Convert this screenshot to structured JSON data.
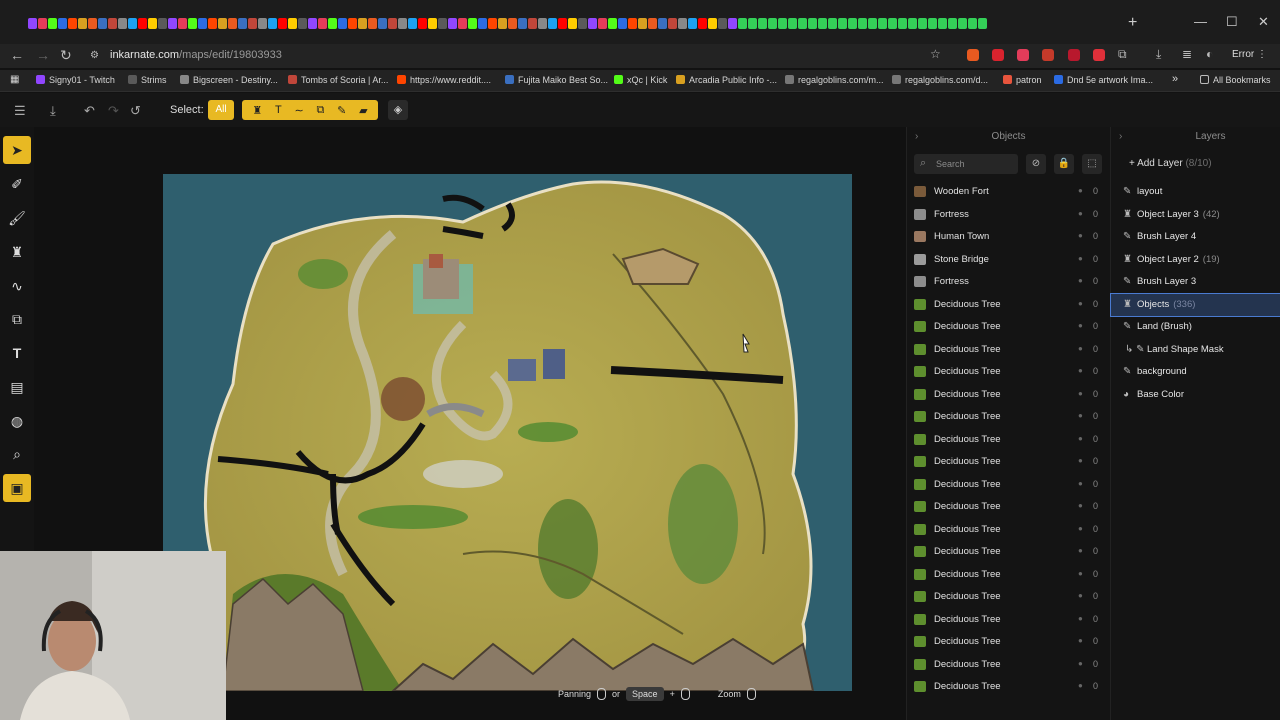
{
  "browser": {
    "url_host": "inkarnate.com",
    "url_path": "/maps/edit/19803933",
    "error_label": "Error",
    "bookmarks": [
      {
        "label": "Signy01 - Twitch",
        "color": "#9146ff"
      },
      {
        "label": "Strims",
        "color": "#5a5a5a"
      },
      {
        "label": "Bigscreen - Destiny...",
        "color": "#888888"
      },
      {
        "label": "Tombs of Scoria | Ar...",
        "color": "#c0463a"
      },
      {
        "label": "https://www.reddit....",
        "color": "#ff4500"
      },
      {
        "label": "Fujita Maiko Best So...",
        "color": "#3a6fc0"
      },
      {
        "label": "xQc | Kick",
        "color": "#53fc18"
      },
      {
        "label": "Arcadia Public Info -...",
        "color": "#d9a020"
      },
      {
        "label": "regalgoblins.com/m...",
        "color": "#777777"
      },
      {
        "label": "regalgoblins.com/d...",
        "color": "#777777"
      },
      {
        "label": "patron",
        "color": "#e8553d"
      },
      {
        "label": "Dnd 5e artwork Ima...",
        "color": "#2b6be3"
      }
    ],
    "all_bookmarks_label": "All Bookmarks"
  },
  "toolbar": {
    "select_label": "Select:",
    "all_label": "All",
    "accent_color": "#e8b923"
  },
  "canvas_hint": {
    "panning_label": "Panning",
    "or_label": "or",
    "space_label": "Space",
    "zoom_label": "Zoom"
  },
  "objects_panel": {
    "title": "Objects",
    "search_placeholder": "Search",
    "items": [
      {
        "name": "Wooden Fort",
        "count": "0",
        "thumb": "#7a5a3a"
      },
      {
        "name": "Fortress",
        "count": "0",
        "thumb": "#8d8d8d"
      },
      {
        "name": "Human Town",
        "count": "0",
        "thumb": "#9a7860"
      },
      {
        "name": "Stone Bridge",
        "count": "0",
        "thumb": "#9b9b9b"
      },
      {
        "name": "Fortress",
        "count": "0",
        "thumb": "#8d8d8d"
      },
      {
        "name": "Deciduous Tree",
        "count": "0",
        "thumb": "#5e8f2e"
      },
      {
        "name": "Deciduous Tree",
        "count": "0",
        "thumb": "#5e8f2e"
      },
      {
        "name": "Deciduous Tree",
        "count": "0",
        "thumb": "#5e8f2e"
      },
      {
        "name": "Deciduous Tree",
        "count": "0",
        "thumb": "#5e8f2e"
      },
      {
        "name": "Deciduous Tree",
        "count": "0",
        "thumb": "#5e8f2e"
      },
      {
        "name": "Deciduous Tree",
        "count": "0",
        "thumb": "#5e8f2e"
      },
      {
        "name": "Deciduous Tree",
        "count": "0",
        "thumb": "#5e8f2e"
      },
      {
        "name": "Deciduous Tree",
        "count": "0",
        "thumb": "#5e8f2e"
      },
      {
        "name": "Deciduous Tree",
        "count": "0",
        "thumb": "#5e8f2e"
      },
      {
        "name": "Deciduous Tree",
        "count": "0",
        "thumb": "#5e8f2e"
      },
      {
        "name": "Deciduous Tree",
        "count": "0",
        "thumb": "#5e8f2e"
      },
      {
        "name": "Deciduous Tree",
        "count": "0",
        "thumb": "#5e8f2e"
      },
      {
        "name": "Deciduous Tree",
        "count": "0",
        "thumb": "#5e8f2e"
      },
      {
        "name": "Deciduous Tree",
        "count": "0",
        "thumb": "#5e8f2e"
      },
      {
        "name": "Deciduous Tree",
        "count": "0",
        "thumb": "#5e8f2e"
      },
      {
        "name": "Deciduous Tree",
        "count": "0",
        "thumb": "#5e8f2e"
      },
      {
        "name": "Deciduous Tree",
        "count": "0",
        "thumb": "#5e8f2e"
      },
      {
        "name": "Deciduous Tree",
        "count": "0",
        "thumb": "#5e8f2e"
      }
    ]
  },
  "layers_panel": {
    "title": "Layers",
    "add_label": "Add Layer",
    "add_count": "(8/10)",
    "items": [
      {
        "name": "layout",
        "count": "",
        "icon": "brush-icon",
        "indent": false,
        "selected": false
      },
      {
        "name": "Object Layer 3",
        "count": "(42)",
        "icon": "object-icon",
        "indent": false,
        "selected": false
      },
      {
        "name": "Brush Layer 4",
        "count": "",
        "icon": "brush-icon",
        "indent": false,
        "selected": false
      },
      {
        "name": "Object Layer 2",
        "count": "(19)",
        "icon": "object-icon",
        "indent": false,
        "selected": false
      },
      {
        "name": "Brush Layer 3",
        "count": "",
        "icon": "brush-icon",
        "indent": false,
        "selected": false
      },
      {
        "name": "Objects",
        "count": "(336)",
        "icon": "object-icon",
        "indent": false,
        "selected": true
      },
      {
        "name": "Land (Brush)",
        "count": "",
        "icon": "brush-icon",
        "indent": false,
        "selected": false
      },
      {
        "name": "Land Shape Mask",
        "count": "",
        "icon": "mask-icon",
        "indent": true,
        "selected": false
      },
      {
        "name": "background",
        "count": "",
        "icon": "brush-icon",
        "indent": false,
        "selected": false
      },
      {
        "name": "Base Color",
        "count": "",
        "icon": "palette-icon",
        "indent": false,
        "selected": false
      }
    ]
  }
}
